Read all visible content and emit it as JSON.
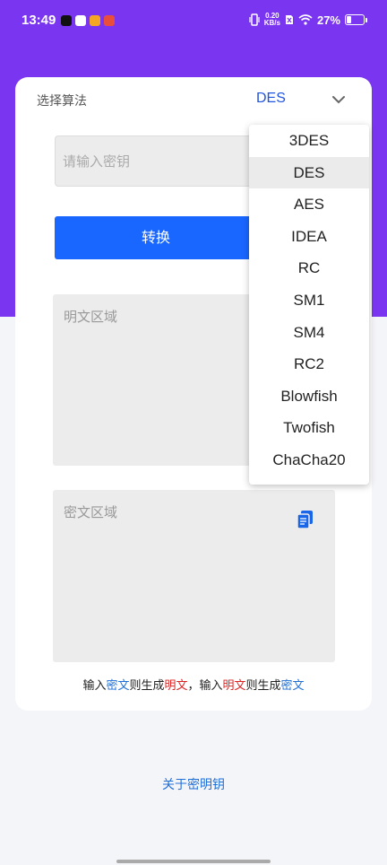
{
  "status": {
    "time": "13:49",
    "net_speed_value": "0.20",
    "net_speed_unit": "KB/s",
    "battery": "27%"
  },
  "form": {
    "algo_label": "选择算法",
    "algo_value": "DES",
    "key_placeholder": "请输入密钥",
    "convert_label": "转换",
    "plain_placeholder": "明文区域",
    "cipher_placeholder": "密文区域"
  },
  "hint": {
    "p1": "输入",
    "p2": "密文",
    "p3": "则生成",
    "p4": "明文",
    "p5": "，输入",
    "p6": "明文",
    "p7": "则生成",
    "p8": "密文"
  },
  "dropdown": {
    "options": [
      "3DES",
      "DES",
      "AES",
      "IDEA",
      "RC",
      "SM1",
      "SM4",
      "RC2",
      "Blowfish",
      "Twofish",
      "ChaCha20"
    ],
    "selected": "DES"
  },
  "footer": {
    "about_label": "关于密明钥"
  },
  "colors": {
    "header": "#7a35f0",
    "button": "#1967ff",
    "link": "#1f6fd6",
    "accent_red": "#dd2222"
  }
}
